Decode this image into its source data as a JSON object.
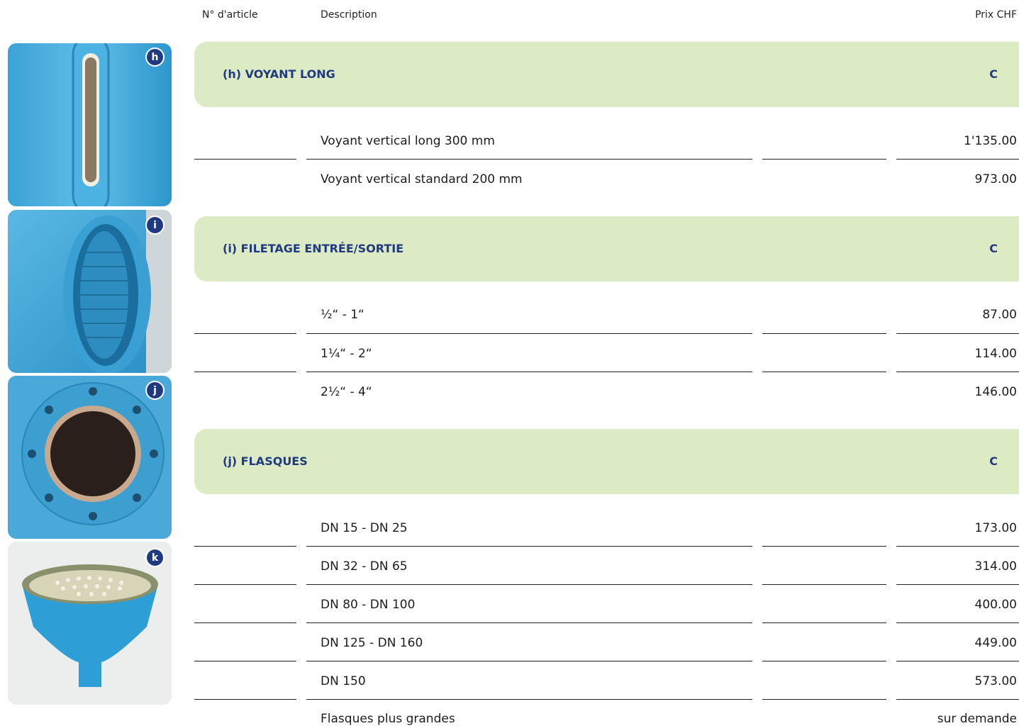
{
  "header": {
    "article_no": "N° d'article",
    "description": "Description",
    "price": "Prix CHF"
  },
  "photos": [
    {
      "badge": "h",
      "icon": "sight-glass-photo"
    },
    {
      "badge": "i",
      "icon": "threaded-port-photo"
    },
    {
      "badge": "j",
      "icon": "flange-photo"
    },
    {
      "badge": "k",
      "icon": "strainer-funnel-photo"
    }
  ],
  "sections": [
    {
      "title": "(h) VOYANT LONG",
      "code": "C",
      "rows": [
        {
          "desc": "Voyant vertical long 300 mm",
          "price": "1'135.00"
        },
        {
          "desc": "Voyant vertical standard 200 mm",
          "price": "973.00"
        }
      ]
    },
    {
      "title": "(i) FILETAGE ENTRÉE/SORTIE",
      "code": "C",
      "rows": [
        {
          "desc": "½“ - 1“",
          "price": "87.00"
        },
        {
          "desc": "1¼“ - 2“",
          "price": "114.00"
        },
        {
          "desc": "2½“ - 4“",
          "price": "146.00"
        }
      ]
    },
    {
      "title": "(j) FLASQUES",
      "code": "C",
      "rows": [
        {
          "desc": "DN 15 - DN 25",
          "price": "173.00"
        },
        {
          "desc": "DN 32 - DN 65",
          "price": "314.00"
        },
        {
          "desc": "DN 80 - DN 100",
          "price": "400.00"
        },
        {
          "desc": "DN 125 - DN 160",
          "price": "449.00"
        },
        {
          "desc": "DN 150",
          "price": "573.00"
        },
        {
          "desc": "Flasques plus grandes",
          "price": "sur demande"
        }
      ]
    }
  ]
}
